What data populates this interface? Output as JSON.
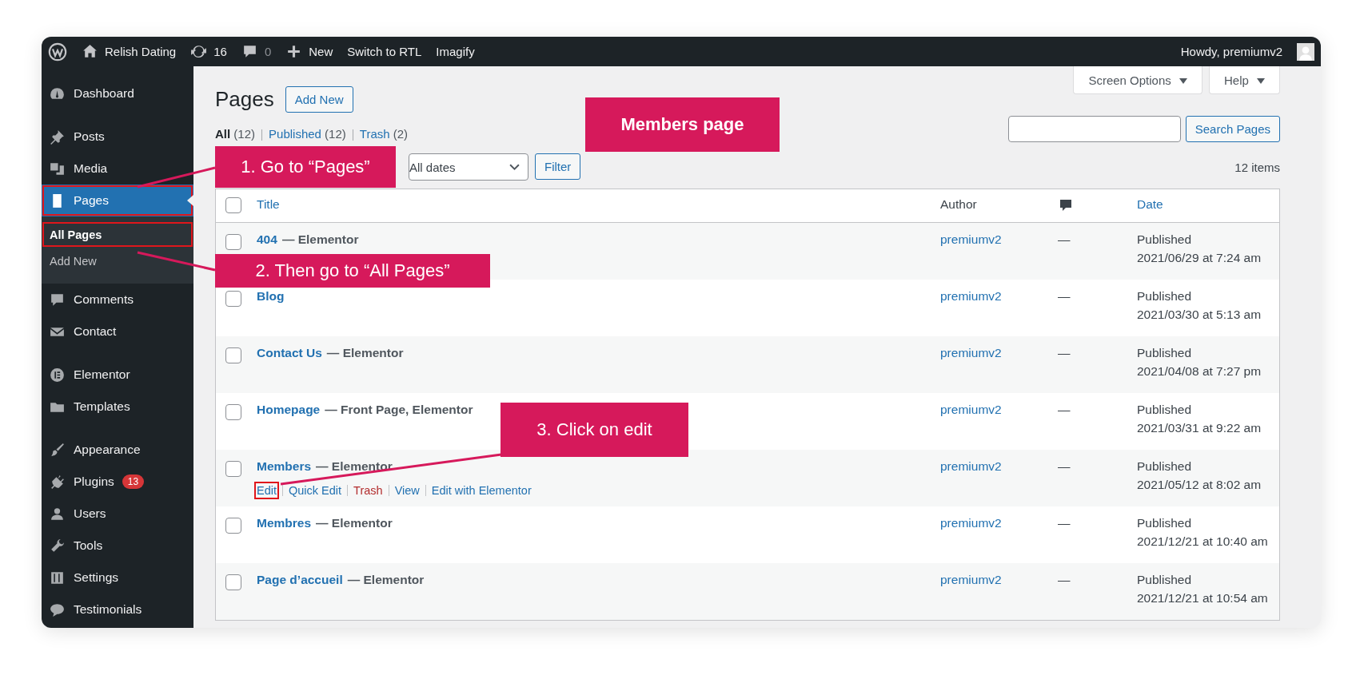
{
  "admin_bar": {
    "site_name": "Relish Dating",
    "updates": "16",
    "comments": "0",
    "new_label": "New",
    "links": [
      "Switch to RTL",
      "Imagify"
    ],
    "greeting": "Howdy, premiumv2"
  },
  "sidebar": {
    "groups": [
      [
        {
          "label": "Dashboard",
          "selected": false,
          "highlighted": false
        }
      ],
      [
        {
          "label": "Posts",
          "selected": false,
          "highlighted": false
        },
        {
          "label": "Media",
          "selected": false,
          "highlighted": false
        },
        {
          "label": "Pages",
          "selected": true,
          "highlighted": true,
          "children": [
            {
              "label": "All Pages",
              "selected": true,
              "highlighted": true
            },
            {
              "label": "Add New",
              "selected": false,
              "highlighted": false
            }
          ]
        },
        {
          "label": "Comments",
          "selected": false,
          "highlighted": false
        },
        {
          "label": "Contact",
          "selected": false,
          "highlighted": false
        }
      ],
      [
        {
          "label": "Elementor",
          "selected": false,
          "highlighted": false
        },
        {
          "label": "Templates",
          "selected": false,
          "highlighted": false
        }
      ],
      [
        {
          "label": "Appearance",
          "selected": false,
          "highlighted": false
        },
        {
          "label": "Plugins",
          "badge": "13",
          "selected": false,
          "highlighted": false
        },
        {
          "label": "Users",
          "selected": false,
          "highlighted": false
        },
        {
          "label": "Tools",
          "selected": false,
          "highlighted": false
        },
        {
          "label": "Settings",
          "selected": false,
          "highlighted": false
        },
        {
          "label": "Testimonials",
          "selected": false,
          "highlighted": false
        }
      ]
    ]
  },
  "page": {
    "title": "Pages",
    "add_new": "Add New",
    "screen_options": "Screen Options",
    "help": "Help",
    "views": [
      {
        "label": "All",
        "count": "(12)",
        "selected": true
      },
      {
        "label": "Published",
        "count": "(12)",
        "selected": false
      },
      {
        "label": "Trash",
        "count": "(2)",
        "selected": false
      }
    ],
    "date_filter": "All dates",
    "filter_button": "Filter",
    "search_button": "Search Pages",
    "item_count": "12 items"
  },
  "table": {
    "columns": [
      "Title",
      "Author",
      "Date"
    ],
    "header_checked": false,
    "rows": [
      {
        "title": "404",
        "state": "— Elementor",
        "author": "premiumv2",
        "comments": "—",
        "status": "Published",
        "date": "2021/06/29 at 7:24 am",
        "checked": false
      },
      {
        "title": "Blog",
        "author": "premiumv2",
        "comments": "—",
        "status": "Published",
        "date": "2021/03/30 at 5:13 am",
        "checked": false
      },
      {
        "title": "Contact Us",
        "state": "— Elementor",
        "author": "premiumv2",
        "comments": "—",
        "status": "Published",
        "date": "2021/04/08 at 7:27 pm",
        "checked": false
      },
      {
        "title": "Homepage",
        "state": "— Front Page, Elementor",
        "author": "premiumv2",
        "comments": "—",
        "status": "Published",
        "date": "2021/03/31 at 9:22 am",
        "checked": false
      },
      {
        "title": "Members",
        "state": "— Elementor",
        "author": "premiumv2",
        "comments": "—",
        "status": "Published",
        "date": "2021/05/12 at 8:02 am",
        "checked": false,
        "actions": [
          {
            "label": "Edit",
            "kind": "link",
            "highlighted": true
          },
          {
            "label": "Quick Edit",
            "kind": "link",
            "highlighted": false
          },
          {
            "label": "Trash",
            "kind": "delete",
            "highlighted": false
          },
          {
            "label": "View",
            "kind": "link",
            "highlighted": false
          },
          {
            "label": "Edit with Elementor",
            "kind": "link",
            "highlighted": false
          }
        ]
      },
      {
        "title": "Membres",
        "state": "— Elementor",
        "author": "premiumv2",
        "comments": "—",
        "status": "Published",
        "date": "2021/12/21 at 10:40 am",
        "checked": false
      },
      {
        "title": "Page d’accueil",
        "state": "— Elementor",
        "author": "premiumv2",
        "comments": "—",
        "status": "Published",
        "date": "2021/12/21 at 10:54 am",
        "checked": false
      }
    ]
  },
  "annotations": [
    {
      "text": "Members page",
      "kind": "title"
    },
    {
      "text": "1. Go to “Pages”",
      "kind": "step"
    },
    {
      "text": "2. Then go to “All Pages”",
      "kind": "step"
    },
    {
      "text": "3. Click on edit",
      "kind": "step"
    }
  ]
}
